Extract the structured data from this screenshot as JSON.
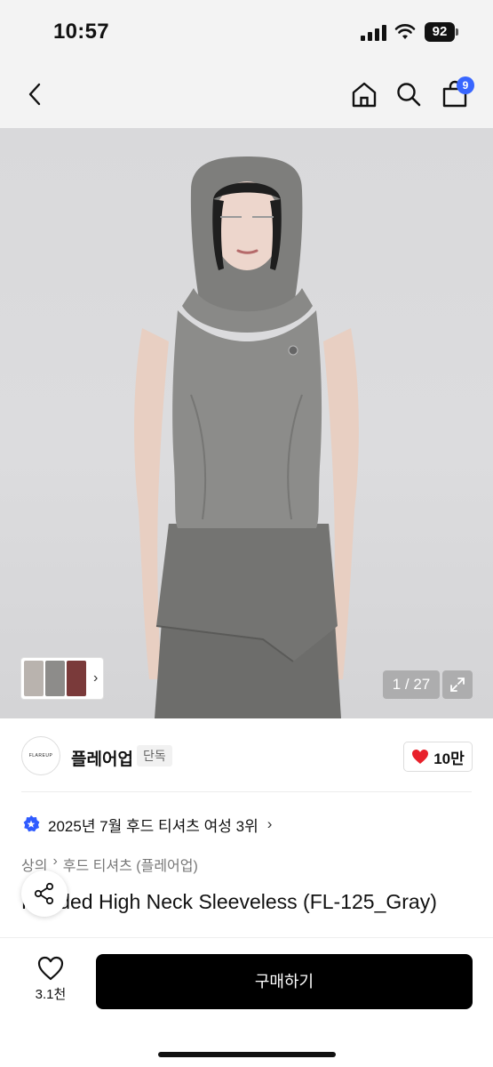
{
  "status": {
    "time": "10:57",
    "battery": "92"
  },
  "nav": {
    "cart_count": "9"
  },
  "hero": {
    "page_counter": "1 / 27"
  },
  "brand": {
    "logo_text": "FLAREUP",
    "name": "플레어업",
    "tag": "단독",
    "likes": "10만"
  },
  "ranking": {
    "text": "2025년 7월 후드 티셔츠 여성 3위"
  },
  "breadcrumb": {
    "category": "상의",
    "subcategory": "후드 티셔츠 (플레어업)"
  },
  "product": {
    "title": "Hooded High Neck Sleeveless (FL-125_Gray)"
  },
  "bottom": {
    "wish_count": "3.1천",
    "buy_label": "구매하기"
  },
  "colors": {
    "accent": "#3866ff",
    "heart": "#e8212b",
    "buy_button": "#000000"
  }
}
